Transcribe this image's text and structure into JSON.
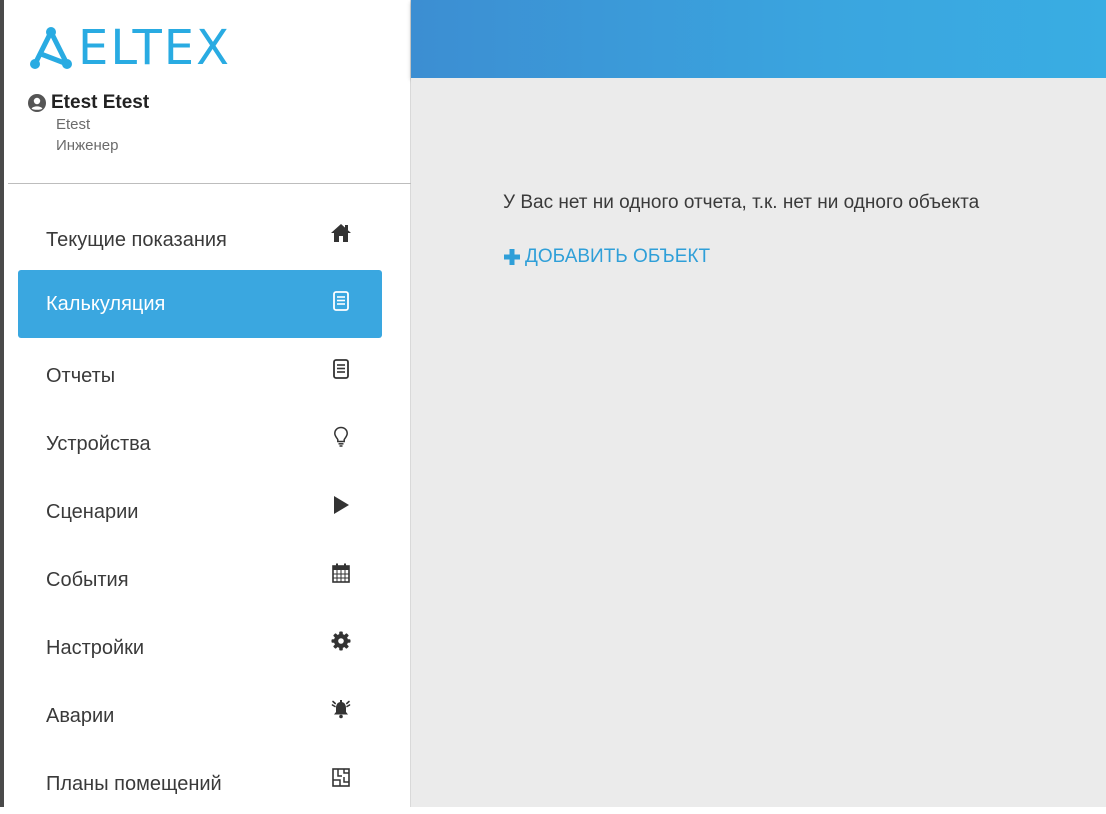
{
  "brand": {
    "name": "ELTEX",
    "color": "#29abe2"
  },
  "user": {
    "name": "Etest Etest",
    "login": "Etest",
    "role": "Инженер",
    "icon": "user-circle-icon"
  },
  "menu": {
    "items": [
      {
        "label": "Текущие показания",
        "icon": "home-icon",
        "active": false
      },
      {
        "label": "Калькуляция",
        "icon": "document-icon",
        "active": true
      },
      {
        "label": "Отчеты",
        "icon": "document-icon",
        "active": false
      },
      {
        "label": "Устройства",
        "icon": "lightbulb-icon",
        "active": false
      },
      {
        "label": "Сценарии",
        "icon": "play-icon",
        "active": false
      },
      {
        "label": "События",
        "icon": "calendar-icon",
        "active": false
      },
      {
        "label": "Настройки",
        "icon": "gear-icon",
        "active": false
      },
      {
        "label": "Аварии",
        "icon": "alarm-bell-icon",
        "active": false
      },
      {
        "label": "Планы помещений",
        "icon": "floor-plan-icon",
        "active": false
      }
    ]
  },
  "main": {
    "empty_message": "У Вас нет ни одного отчета, т.к. нет ни одного объекта",
    "add_object_label": "ДОБАВИТЬ ОБЪЕКТ"
  },
  "colors": {
    "accent": "#3aa7e0",
    "topbar": "#3aa5df",
    "content_bg": "#ebebeb"
  }
}
